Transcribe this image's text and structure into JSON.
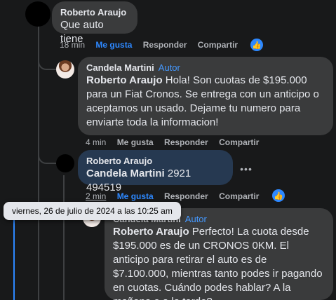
{
  "comments": [
    {
      "author": "Roberto Araujo",
      "text": "Que auto tiene",
      "time": "18 min",
      "like": "Me gusta",
      "reply": "Responder",
      "share": "Compartir"
    },
    {
      "author": "Candela Martini",
      "tag": "Autor",
      "mention": "Roberto Araujo",
      "text": " Hola! Son cuotas de $195.000 para un Fiat Cronos. Se entrega con un anticipo o aceptamos un usado. Dejame tu numero para enviarte toda la informacion!",
      "time": "4 min",
      "like": "Me gusta",
      "reply": "Responder",
      "share": "Compartir"
    },
    {
      "author": "Roberto Araujo",
      "mention": "Candela Martini",
      "text": " 2921 494519",
      "time": "2 min",
      "like": "Me gusta",
      "reply": "Responder",
      "share": "Compartir"
    },
    {
      "author": "Candela Martini",
      "tag": "Autor",
      "mention": "Roberto Araujo",
      "text": " Perfecto! La cuota desde $195.000 es de un CRONOS 0KM. El anticipo para retirar el auto es de $7.100.000, mientras tanto podes ir pagando en cuotas. Cuándo podes hablar? A la mañana o a la tarde?"
    }
  ],
  "tooltip": "viernes, 26 de julio de 2024 a las 10:25 am",
  "more_options": "•••",
  "like_badge": "👍",
  "colors": {
    "background": "#18191a",
    "bubble": "#3a3b3c",
    "bubble_highlight": "#263951",
    "accent": "#2d88ff",
    "author_tag": "#4599ff"
  }
}
